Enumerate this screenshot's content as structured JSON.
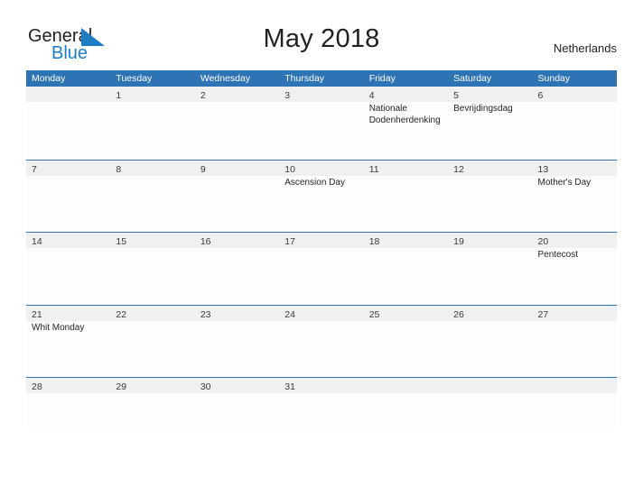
{
  "brand": {
    "word_one": "General",
    "word_two": "Blue"
  },
  "header": {
    "title": "May 2018",
    "country": "Netherlands"
  },
  "colors": {
    "header_blue": "#2e74b5",
    "logo_blue": "#1f7dc4",
    "strip_gray": "#f0f0f0",
    "text_dark": "#231f20"
  },
  "weekdays": [
    "Monday",
    "Tuesday",
    "Wednesday",
    "Thursday",
    "Friday",
    "Saturday",
    "Sunday"
  ],
  "weeks": [
    [
      {
        "date": "",
        "event": ""
      },
      {
        "date": "1",
        "event": ""
      },
      {
        "date": "2",
        "event": ""
      },
      {
        "date": "3",
        "event": ""
      },
      {
        "date": "4",
        "event": "Nationale Dodenherdenking"
      },
      {
        "date": "5",
        "event": "Bevrijdingsdag"
      },
      {
        "date": "6",
        "event": ""
      }
    ],
    [
      {
        "date": "7",
        "event": ""
      },
      {
        "date": "8",
        "event": ""
      },
      {
        "date": "9",
        "event": ""
      },
      {
        "date": "10",
        "event": "Ascension Day"
      },
      {
        "date": "11",
        "event": ""
      },
      {
        "date": "12",
        "event": ""
      },
      {
        "date": "13",
        "event": "Mother's Day"
      }
    ],
    [
      {
        "date": "14",
        "event": ""
      },
      {
        "date": "15",
        "event": ""
      },
      {
        "date": "16",
        "event": ""
      },
      {
        "date": "17",
        "event": ""
      },
      {
        "date": "18",
        "event": ""
      },
      {
        "date": "19",
        "event": ""
      },
      {
        "date": "20",
        "event": "Pentecost"
      }
    ],
    [
      {
        "date": "21",
        "event": "Whit Monday"
      },
      {
        "date": "22",
        "event": ""
      },
      {
        "date": "23",
        "event": ""
      },
      {
        "date": "24",
        "event": ""
      },
      {
        "date": "25",
        "event": ""
      },
      {
        "date": "26",
        "event": ""
      },
      {
        "date": "27",
        "event": ""
      }
    ],
    [
      {
        "date": "28",
        "event": ""
      },
      {
        "date": "29",
        "event": ""
      },
      {
        "date": "30",
        "event": ""
      },
      {
        "date": "31",
        "event": ""
      },
      {
        "date": "",
        "event": ""
      },
      {
        "date": "",
        "event": ""
      },
      {
        "date": "",
        "event": ""
      }
    ]
  ]
}
